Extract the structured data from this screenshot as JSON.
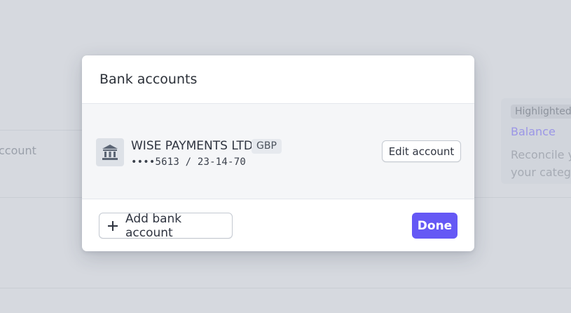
{
  "background": {
    "account_text": "ccount",
    "highlight_badge": "Highlighted",
    "balance_link": "Balance",
    "desc_line1": "Reconcile y",
    "desc_line2": "your catego"
  },
  "modal": {
    "title": "Bank accounts",
    "account": {
      "name": "WISE PAYMENTS LTD",
      "currency": "GBP",
      "number": "••••5613 / 23-14-70",
      "icon": "bank-icon"
    },
    "edit_label": "Edit account",
    "add_label": "Add bank account",
    "done_label": "Done"
  },
  "colors": {
    "accent": "#6558f5",
    "overlay": "#d6d9df"
  }
}
